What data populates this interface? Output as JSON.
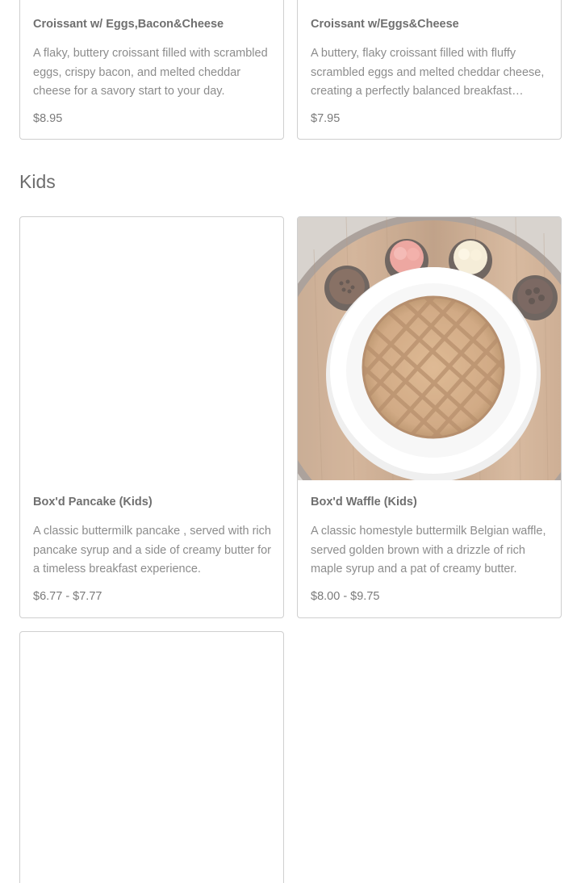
{
  "top_items": [
    {
      "title": "Croissant w/ Eggs,Bacon&Cheese",
      "description": "A flaky, buttery croissant filled with scrambled eggs, crispy bacon, and melted cheddar cheese for a savory start to your day.",
      "price": "$8.95"
    },
    {
      "title": "Croissant w/Eggs&Cheese",
      "description": "A buttery, flaky croissant filled with fluffy scrambled eggs and melted cheddar cheese, creating a perfectly balanced breakfast sandwich.",
      "price": "$7.95"
    }
  ],
  "kids_section": {
    "title": "Kids",
    "items": [
      {
        "title": "Box'd Pancake (Kids)",
        "description": "A classic buttermilk pancake , served with rich pancake syrup and a side of creamy butter for a timeless breakfast experience.",
        "price": "$6.77 - $7.77"
      },
      {
        "title": "Box'd Waffle (Kids)",
        "description": "A classic homestyle buttermilk Belgian waffle, served golden brown with a drizzle of rich maple syrup and a pat of creamy butter.",
        "price": "$8.00 - $9.75",
        "image_icon": "waffle-photo"
      }
    ]
  }
}
